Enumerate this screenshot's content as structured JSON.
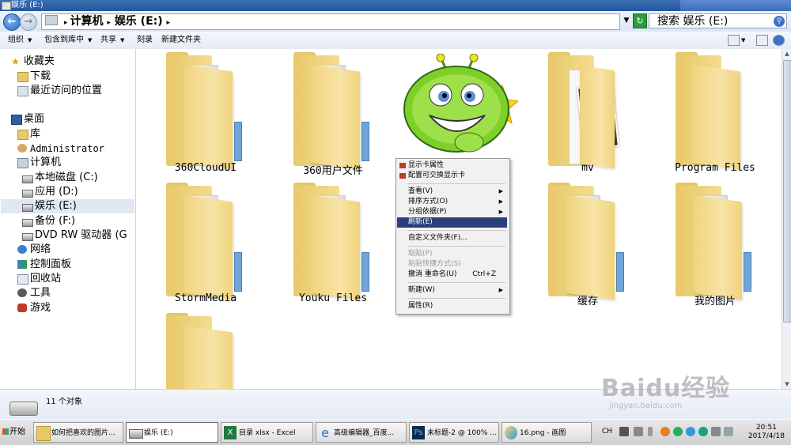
{
  "window": {
    "title": "娱乐 (E:)"
  },
  "address": {
    "path_parts": [
      "计算机",
      "娱乐 (E:)"
    ],
    "separator": "▸",
    "search_placeholder": "搜索 娱乐 (E:)"
  },
  "toolbar": {
    "organize": "组织",
    "include_in_library": "包含到库中",
    "share": "共享",
    "burn": "刻录",
    "new_folder": "新建文件夹"
  },
  "nav": {
    "favorites": "收藏夹",
    "downloads": "下载",
    "recent": "最近访问的位置",
    "desktop": "桌面",
    "libraries": "库",
    "user": "Administrator",
    "computer": "计算机",
    "drives": [
      "本地磁盘 (C:)",
      "应用 (D:)",
      "娱乐 (E:)",
      "备份 (F:)",
      "DVD RW 驱动器 (G"
    ],
    "network": "网络",
    "control_panel": "控制面板",
    "recycle_bin": "回收站",
    "tools": "工具",
    "games": "游戏"
  },
  "folders": [
    "360CloudUI",
    "360用户文件",
    "mv",
    "Program Files",
    "StormMedia",
    "Youku Files",
    "缓存",
    "我的图片"
  ],
  "context_menu": {
    "display_props": "显示卡属性",
    "switchable_gpu": "配置可交换显示卡",
    "view": "查看(V)",
    "sort_by": "排序方式(O)",
    "group_by": "分组依据(P)",
    "refresh": "刷新(E)",
    "customize": "自定义文件夹(F)...",
    "paste": "粘贴(P)",
    "paste_shortcut": "粘贴快捷方式(S)",
    "undo_rename": "撤消 重命名(U)",
    "undo_shortcut": "Ctrl+Z",
    "new": "新建(W)",
    "properties": "属性(R)"
  },
  "details": {
    "count": "11 个对象"
  },
  "taskbar": {
    "start": "开始",
    "tasks": [
      "如何把喜欢的图片...",
      "娱乐 (E:)",
      "目录 xlsx - Excel",
      "高级编辑器_百度...",
      "未标题-2 @ 100% ...",
      "16.png - 画图"
    ],
    "lang": "CH",
    "time": "20:51",
    "date": "2017/4/18"
  },
  "watermark": {
    "brand": "Baidu经验",
    "url": "jingyan.baidu.com"
  },
  "colors": {
    "menu_highlight": "#2b3f7c",
    "folder_yellow": "#f3dc8e",
    "selection": "#dfe8f3"
  }
}
